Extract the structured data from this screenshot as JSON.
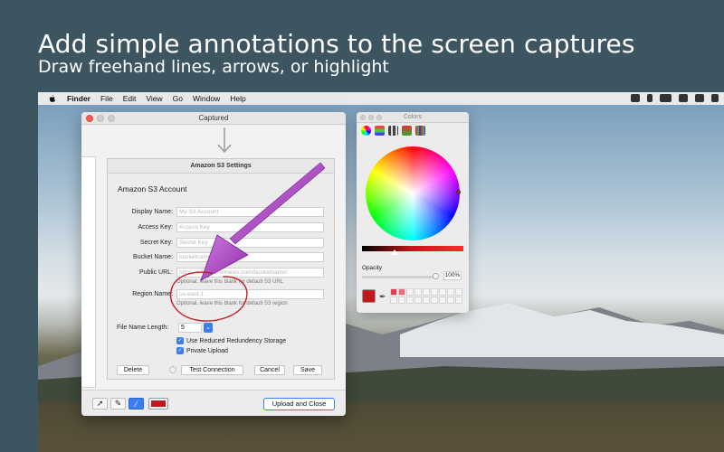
{
  "headline": "Add simple annotations to the screen captures",
  "subhead": "Draw freehand lines, arrows, or highlight",
  "menubar": {
    "items": [
      "Finder",
      "File",
      "Edit",
      "View",
      "Go",
      "Window",
      "Help"
    ]
  },
  "captured_window": {
    "title": "Captured",
    "upload_label": "Upload and Close",
    "tools": [
      "arrow-tool",
      "pencil-tool",
      "line-tool"
    ],
    "stroke_color": "#c2181b"
  },
  "settings": {
    "title": "Amazon S3 Settings",
    "section": "Amazon S3 Account",
    "fields": [
      {
        "label": "Display Name:",
        "placeholder": "My S3 Account"
      },
      {
        "label": "Access Key:",
        "placeholder": "Access Key"
      },
      {
        "label": "Secret Key:",
        "placeholder": "Secret Key"
      },
      {
        "label": "Bucket Name:",
        "placeholder": "bucketname"
      },
      {
        "label": "Public URL:",
        "placeholder": "https://s3.amazonnews.com/bucketname/"
      },
      {
        "label": "Region Name:",
        "placeholder": "us-east-1"
      }
    ],
    "public_url_hint": "Optional, leave this blank for default S3 URL",
    "region_hint": "Optional, leave this blank for default S3 region",
    "file_name_length_label": "File Name Length:",
    "file_name_length_value": "5",
    "reduced_redundancy_label": "Use Reduced Redundency Storage",
    "private_upload_label": "Private Upload",
    "delete_label": "Delete",
    "test_label": "Test Connection",
    "cancel_label": "Cancel",
    "save_label": "Save"
  },
  "colors_panel": {
    "title": "Colors",
    "opacity_label": "Opacity",
    "opacity_value": "100%",
    "current_color": "#c2181b"
  },
  "annotation": {
    "arrow_color": "#a23cc0",
    "circle_color": "#c41b22"
  }
}
